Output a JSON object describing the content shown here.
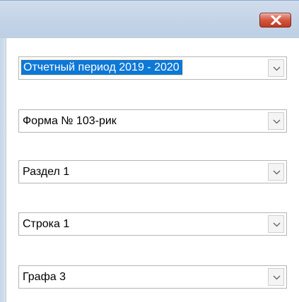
{
  "window": {
    "close_icon": "close-icon",
    "close_color": "#c13a20"
  },
  "combos": [
    {
      "value": "Отчетный период 2019 - 2020",
      "selected": true
    },
    {
      "value": "Форма № 103-рик"
    },
    {
      "value": "Раздел 1"
    },
    {
      "value": "Строка 1"
    },
    {
      "value": "Графа 3"
    }
  ],
  "icons": {
    "dropdown": "chevron-down-icon"
  },
  "colors": {
    "selection": "#0e78d7",
    "titlebar": "#c3d3e6"
  }
}
